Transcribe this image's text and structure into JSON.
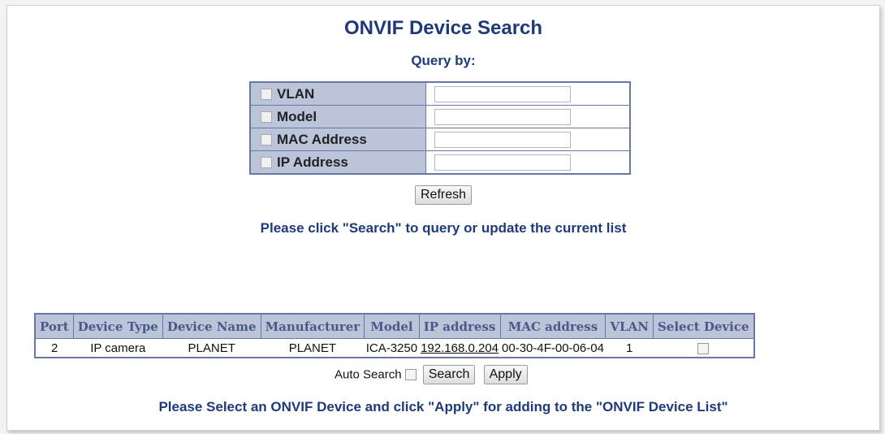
{
  "header": {
    "title": "ONVIF Device Search",
    "subtitle": "Query by:"
  },
  "query_fields": [
    {
      "label": "VLAN",
      "value": ""
    },
    {
      "label": "Model",
      "value": ""
    },
    {
      "label": "MAC Address",
      "value": ""
    },
    {
      "label": "IP Address",
      "value": ""
    }
  ],
  "buttons": {
    "refresh": "Refresh",
    "search": "Search",
    "apply": "Apply"
  },
  "notes": {
    "search_hint": "Please click \"Search\" to query or update the current list",
    "apply_hint": "Please Select an ONVIF Device and click \"Apply\" for adding to the \"ONVIF Device List\""
  },
  "results": {
    "columns": [
      "Port",
      "Device Type",
      "Device Name",
      "Manufacturer",
      "Model",
      "IP address",
      "MAC address",
      "VLAN",
      "Select Device"
    ],
    "rows": [
      {
        "port": "2",
        "device_type": "IP camera",
        "device_name": "PLANET",
        "manufacturer": "PLANET",
        "model": "ICA-3250",
        "ip": "192.168.0.204",
        "mac": "00-30-4F-00-06-04",
        "vlan": "1",
        "selected": false
      }
    ]
  },
  "auto_search": {
    "label": "Auto Search",
    "checked": false
  },
  "colors": {
    "title": "#1f3a7a",
    "header_bg": "#bcc4da",
    "border": "#6677a8"
  }
}
